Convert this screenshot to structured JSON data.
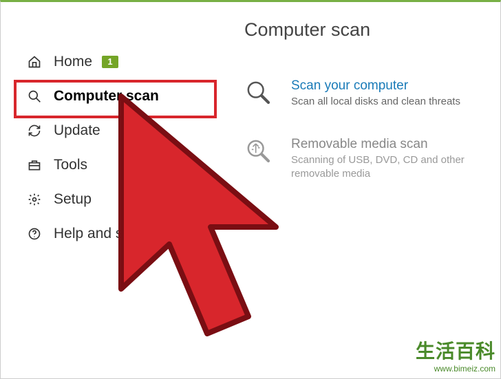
{
  "sidebar": {
    "items": [
      {
        "label": "Home",
        "badge": "1"
      },
      {
        "label": "Computer scan"
      },
      {
        "label": "Update"
      },
      {
        "label": "Tools"
      },
      {
        "label": "Setup"
      },
      {
        "label": "Help and support"
      }
    ]
  },
  "main": {
    "title": "Computer scan",
    "options": [
      {
        "title": "Scan your computer",
        "sub": "Scan all local disks and clean threats"
      },
      {
        "title": "Removable media scan",
        "sub": "Scanning of USB, DVD, CD and other removable media"
      }
    ]
  },
  "watermark": {
    "cn": "生活百科",
    "url": "www.bimeiz.com"
  }
}
